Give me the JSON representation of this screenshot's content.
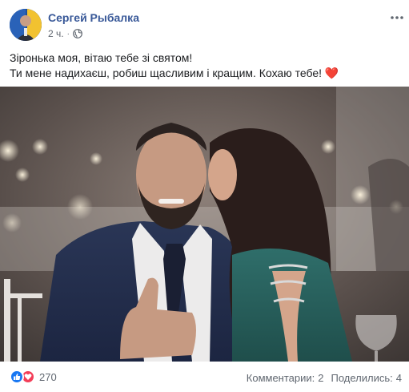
{
  "post": {
    "author": "Сергей Рыбалка",
    "time": "2 ч.",
    "separator": "·",
    "privacy_icon": "globe-icon",
    "more_icon": "more-options-icon",
    "text_line1": "Зіронька моя, вітаю тебе зі святом!",
    "text_line2": "Ти мене надихаєш, робиш щасливим і кращим. Кохаю тебе!",
    "text_emoji": "❤️"
  },
  "reactions": {
    "icons": [
      "like-icon",
      "love-icon"
    ],
    "count": "270"
  },
  "stats": {
    "comments_label": "Комментарии:",
    "comments_count": "2",
    "shares_label": "Поделились:",
    "shares_count": "4"
  },
  "colors": {
    "author_link": "#385898",
    "like": "#1877f2",
    "love": "#f33e58",
    "muted": "#606770"
  }
}
